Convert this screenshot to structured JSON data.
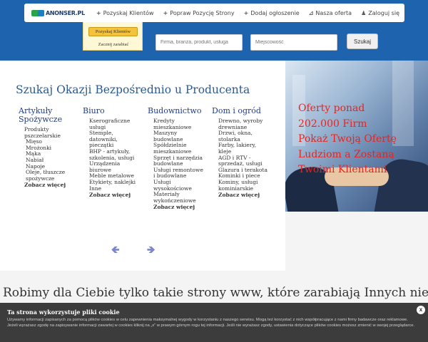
{
  "navbar": {
    "logo_text": "ANONSER.PL",
    "items": [
      {
        "icon": "plus-icon",
        "glyph": "+",
        "label": "Pozyskaj Klientów"
      },
      {
        "icon": "plus-icon",
        "glyph": "+",
        "label": "Popraw Pozycję Strony"
      },
      {
        "icon": "plus-icon",
        "glyph": "+",
        "label": "Dodaj ogłoszenie"
      },
      {
        "icon": "ruler-icon",
        "glyph": "⊿",
        "label": "Nasza oferta"
      }
    ],
    "login": {
      "icon": "user-icon",
      "glyph": "♟",
      "label": "Zaloguj się"
    }
  },
  "dropdown": {
    "button_label": "Pozyskaj Klientów",
    "link_label": "Zacznij zarabiać"
  },
  "search": {
    "firm_placeholder": "Firma, branża, produkt, usługa",
    "city_placeholder": "Miejscowość",
    "button_label": "Szukaj"
  },
  "main": {
    "headline": "Szukaj Okazji Bezpośrednio u Producenta",
    "columns": [
      {
        "title": "Artykuły Spożywcze",
        "items": [
          "Produkty pszczelarskie",
          "Mięso",
          "Mrożonki",
          "Mąka",
          "Nabiał",
          "Napoje",
          "Oleje, tłuszcze spożywcze"
        ],
        "more": "Zobacz więcej"
      },
      {
        "title": "Biuro",
        "items": [
          "Kserograficzne usługi",
          "Stemple, datowniki, pieczątki",
          "BHP - artykuły, szkolenia, usługi",
          "Urządzenia biurowe",
          "Meble metalowe",
          "Etykiety, naklejki",
          "Inne"
        ],
        "more": "Zobacz więcej"
      },
      {
        "title": "Budownictwo",
        "items": [
          "Kredyty mieszkaniowe",
          "Maszyny budowlane",
          "Spółdzielnie mieszkaniowe",
          "Sprzęt i narzędzia budowlane",
          "Usługi remontowe i budowlane",
          "Usługi wysokościowe",
          "Materiały wykończeniowe"
        ],
        "more": "Zobacz więcej"
      },
      {
        "title": "Dom i ogród",
        "items": [
          "Drewno, wyroby drewniane",
          "Drzwi, okna, stolarka",
          "Farby, lakiery, kleje",
          "AGD i RTV - sprzedaż, usługi",
          "Glazura i terakota",
          "Kominki i piece",
          "Kominy, usługi kominiarskie"
        ],
        "more": "Zobacz więcej"
      }
    ],
    "arrow_left": "🡸",
    "arrow_right": "🡺"
  },
  "hero": {
    "lines": [
      "Oferty ponad",
      "202.000 Firm",
      "Pokaż Twoją Ofertę",
      "Ludziom a Zostaną",
      "Twoimi Klientami"
    ]
  },
  "tagline": "Robimy dla Ciebie tylko takie strony www, które zarabiają Innych nie",
  "cookie": {
    "title": "Ta strona wykorzystuje pliki cookie",
    "text": "Używamy informacji zapisanych za pomocą plików cookies w celu zapewnienia maksymalnej wygody w korzystaniu z naszego serwisu. Mogą też korzystać z nich współpracujące z nami firmy badawcze oraz reklamowe. Jeżeli wyrażasz zgodę na zapisywanie informacji zawartej w cookies kliknij na „x” w prawym górnym rogu tej informacji. Jeśli nie wyrażasz zgody, ustawienia dotyczące plików cookies możesz zmienić w swojej przeglądarce.",
    "close_glyph": "x"
  }
}
